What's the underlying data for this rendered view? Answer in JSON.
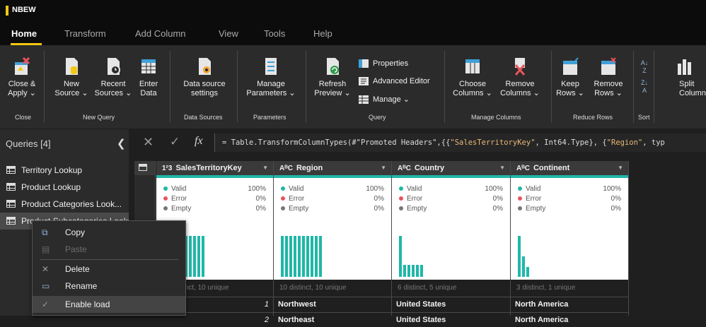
{
  "app": {
    "title": "NBEW"
  },
  "tabs": [
    "Home",
    "Transform",
    "Add Column",
    "View",
    "Tools",
    "Help"
  ],
  "ribbon": {
    "buttons": {
      "close_apply": "Close &\nApply ⌄",
      "new_source": "New\nSource ⌄",
      "recent_sources": "Recent\nSources ⌄",
      "enter_data": "Enter\nData",
      "data_source_settings": "Data source\nsettings",
      "manage_parameters": "Manage\nParameters ⌄",
      "refresh_preview": "Refresh\nPreview ⌄",
      "properties": "Properties",
      "advanced_editor": "Advanced Editor",
      "manage": "Manage ⌄",
      "choose_columns": "Choose\nColumns ⌄",
      "remove_columns": "Remove\nColumns ⌄",
      "keep_rows": "Keep\nRows ⌄",
      "remove_rows": "Remove\nRows ⌄",
      "split_column": "Split\nColumn ⌄"
    },
    "groups": {
      "close": "Close",
      "new_query": "New Query",
      "data_sources": "Data Sources",
      "parameters": "Parameters",
      "query": "Query",
      "manage_columns": "Manage Columns",
      "reduce_rows": "Reduce Rows",
      "sort": "Sort"
    }
  },
  "queries": {
    "header": "Queries [4]",
    "items": [
      "Territory Lookup",
      "Product Lookup",
      "Product Categories Look...",
      "Product Subcategories Lookup"
    ]
  },
  "formula_bar": {
    "prefix": "= Table.TransformColumnTypes(#\"Promoted Headers\",{{",
    "s1": "\"SalesTerritoryKey\"",
    "mid": ", Int64.Type}, {",
    "s2": "\"Region\"",
    "tail": ", typ"
  },
  "columns": [
    {
      "type_icon": "1²3",
      "name": "SalesTerritoryKey",
      "valid": "100%",
      "error": "0%",
      "empty": "0%",
      "distinct": "10 distinct, 10 unique",
      "bars": [
        1,
        1,
        1,
        1,
        1,
        1,
        1,
        1,
        1,
        1
      ],
      "cells": [
        "1",
        "2"
      ]
    },
    {
      "type_icon": "AᴮC",
      "name": "Region",
      "valid": "100%",
      "error": "0%",
      "empty": "0%",
      "distinct": "10 distinct, 10 unique",
      "bars": [
        1,
        1,
        1,
        1,
        1,
        1,
        1,
        1,
        1,
        1
      ],
      "cells": [
        "Northwest",
        "Northeast"
      ]
    },
    {
      "type_icon": "AᴮC",
      "name": "Country",
      "valid": "100%",
      "error": "0%",
      "empty": "0%",
      "distinct": "6 distinct, 5 unique",
      "bars": [
        1,
        0.3,
        0.3,
        0.3,
        0.3,
        0.3
      ],
      "cells": [
        "United States",
        "United States"
      ]
    },
    {
      "type_icon": "AᴮC",
      "name": "Continent",
      "valid": "100%",
      "error": "0%",
      "empty": "0%",
      "distinct": "3 distinct, 1 unique",
      "bars": [
        1,
        0.5,
        0.25
      ],
      "cells": [
        "North America",
        "North America"
      ]
    }
  ],
  "profile_labels": {
    "valid": "Valid",
    "error": "Error",
    "empty": "Empty"
  },
  "colors": {
    "accent": "#f2c811",
    "teal": "#1fb7a8",
    "valid": "#1fb7a8",
    "error": "#e8545c",
    "empty": "#777777"
  },
  "context_menu": {
    "items": [
      {
        "label": "Copy",
        "icon": "copy-icon",
        "enabled": true
      },
      {
        "label": "Paste",
        "icon": "paste-icon",
        "enabled": false
      },
      {
        "label": "Delete",
        "icon": "delete-icon",
        "enabled": true
      },
      {
        "label": "Rename",
        "icon": "rename-icon",
        "enabled": true
      },
      {
        "label": "Enable load",
        "icon": "check-icon",
        "enabled": true
      }
    ]
  }
}
